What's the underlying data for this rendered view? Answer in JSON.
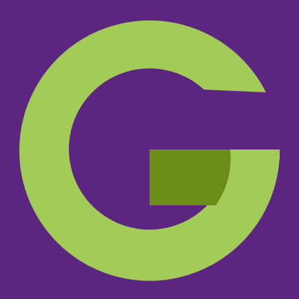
{
  "icon": {
    "name": "g-logo-icon",
    "colors": {
      "background": "#5B2580",
      "ring": "#A2CB57",
      "accent": "#6A8E16"
    }
  }
}
